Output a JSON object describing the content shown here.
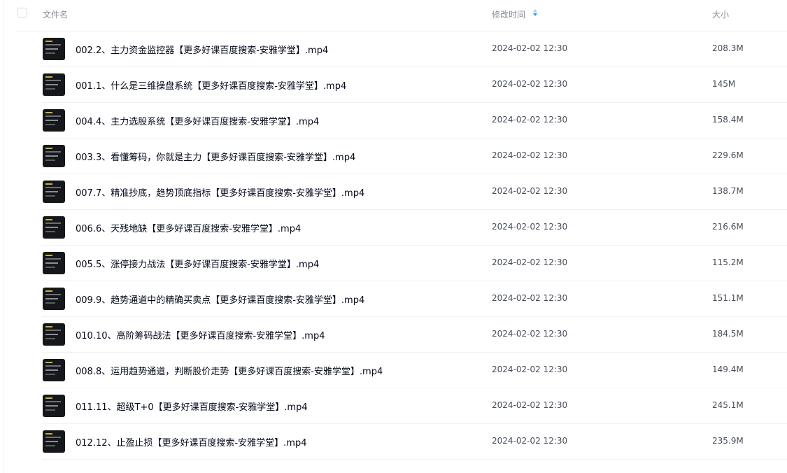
{
  "header": {
    "name_label": "文件名",
    "time_label": "修改时间",
    "size_label": "大小"
  },
  "files": [
    {
      "name": "002.2、主力资金监控器【更多好课百度搜索-安雅学堂】.mp4",
      "modified": "2024-02-02 12:30",
      "size": "208.3M"
    },
    {
      "name": "001.1、什么是三维操盘系统【更多好课百度搜索-安雅学堂】.mp4",
      "modified": "2024-02-02 12:30",
      "size": "145M"
    },
    {
      "name": "004.4、主力选股系统【更多好课百度搜索-安雅学堂】.mp4",
      "modified": "2024-02-02 12:30",
      "size": "158.4M"
    },
    {
      "name": "003.3、看懂筹码，你就是主力【更多好课百度搜索-安雅学堂】.mp4",
      "modified": "2024-02-02 12:30",
      "size": "229.6M"
    },
    {
      "name": "007.7、精准抄底，趋势顶底指标【更多好课百度搜索-安雅学堂】.mp4",
      "modified": "2024-02-02 12:30",
      "size": "138.7M"
    },
    {
      "name": "006.6、天残地缺【更多好课百度搜索-安雅学堂】.mp4",
      "modified": "2024-02-02 12:30",
      "size": "216.6M"
    },
    {
      "name": "005.5、涨停接力战法【更多好课百度搜索-安雅学堂】.mp4",
      "modified": "2024-02-02 12:30",
      "size": "115.2M"
    },
    {
      "name": "009.9、趋势通道中的精确买卖点【更多好课百度搜索-安雅学堂】.mp4",
      "modified": "2024-02-02 12:30",
      "size": "151.1M"
    },
    {
      "name": "010.10、高阶筹码战法【更多好课百度搜索-安雅学堂】.mp4",
      "modified": "2024-02-02 12:30",
      "size": "184.5M"
    },
    {
      "name": "008.8、运用趋势通道，判断股价走势【更多好课百度搜索-安雅学堂】.mp4",
      "modified": "2024-02-02 12:30",
      "size": "149.4M"
    },
    {
      "name": "011.11、超级T+0【更多好课百度搜索-安雅学堂】.mp4",
      "modified": "2024-02-02 12:30",
      "size": "245.1M"
    },
    {
      "name": "012.12、止盈止损【更多好课百度搜索-安雅学堂】.mp4",
      "modified": "2024-02-02 12:30",
      "size": "235.9M"
    }
  ],
  "colors": {
    "sort_active": "#06a7ff",
    "sort_inactive": "#c4c9d2"
  },
  "icons": {
    "thumbnail": "video-thumbnail-icon",
    "sort": "sort-arrows-icon",
    "select": "checkbox-icon"
  }
}
